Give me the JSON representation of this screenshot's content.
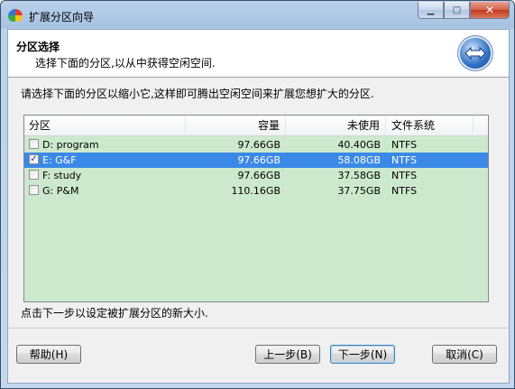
{
  "window": {
    "title": "扩展分区向导",
    "minimize": "▁",
    "maximize": "□",
    "close": "✕"
  },
  "header": {
    "title": "分区选择",
    "subtitle": "选择下面的分区,以从中获得空闲空间."
  },
  "instruction": "请选择下面的分区以缩小它,这样即可腾出空闲空间来扩展您想扩大的分区.",
  "table": {
    "columns": [
      "分区",
      "容量",
      "未使用",
      "文件系统"
    ],
    "rows": [
      {
        "checked": false,
        "selected": false,
        "check": "",
        "name": "D: program",
        "capacity": "97.66GB",
        "free": "40.40GB",
        "fs": "NTFS"
      },
      {
        "checked": true,
        "selected": true,
        "check": "✓",
        "name": "E: G&F",
        "capacity": "97.66GB",
        "free": "58.08GB",
        "fs": "NTFS"
      },
      {
        "checked": false,
        "selected": false,
        "check": "",
        "name": "F: study",
        "capacity": "97.66GB",
        "free": "37.58GB",
        "fs": "NTFS"
      },
      {
        "checked": false,
        "selected": false,
        "check": "",
        "name": "G: P&M",
        "capacity": "110.16GB",
        "free": "37.75GB",
        "fs": "NTFS"
      }
    ]
  },
  "hint": "点击下一步以设定被扩展分区的新大小.",
  "buttons": {
    "help": "帮助(H)",
    "prev": "上一步(B)",
    "next": "下一步(N)",
    "cancel": "取消(C)"
  },
  "colors": {
    "list_background": "#cde9cd",
    "selection": "#3b89e6",
    "title_bar": "#b9d1ea"
  }
}
